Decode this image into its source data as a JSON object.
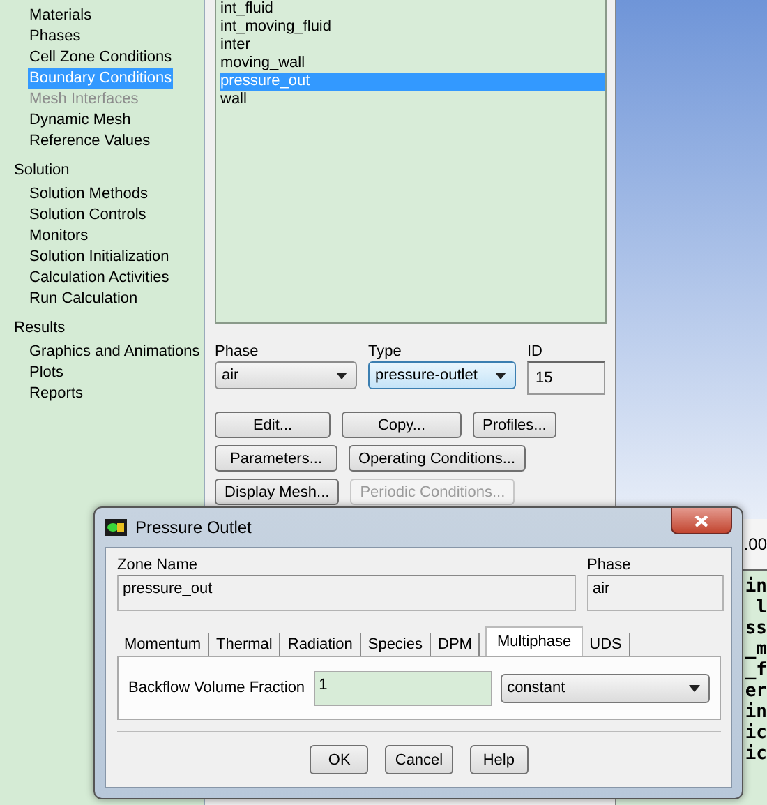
{
  "sidebar": {
    "groups": [
      {
        "items": [
          {
            "label": "Materials",
            "selected": false,
            "disabled": false
          },
          {
            "label": "Phases",
            "selected": false,
            "disabled": false
          },
          {
            "label": "Cell Zone Conditions",
            "selected": false,
            "disabled": false
          },
          {
            "label": "Boundary Conditions",
            "selected": true,
            "disabled": false
          },
          {
            "label": "Mesh Interfaces",
            "selected": false,
            "disabled": true
          },
          {
            "label": "Dynamic Mesh",
            "selected": false,
            "disabled": false
          },
          {
            "label": "Reference Values",
            "selected": false,
            "disabled": false
          }
        ]
      },
      {
        "title": "Solution",
        "items": [
          {
            "label": "Solution Methods",
            "selected": false,
            "disabled": false
          },
          {
            "label": "Solution Controls",
            "selected": false,
            "disabled": false
          },
          {
            "label": "Monitors",
            "selected": false,
            "disabled": false
          },
          {
            "label": "Solution Initialization",
            "selected": false,
            "disabled": false
          },
          {
            "label": "Calculation Activities",
            "selected": false,
            "disabled": false
          },
          {
            "label": "Run Calculation",
            "selected": false,
            "disabled": false
          }
        ]
      },
      {
        "title": "Results",
        "items": [
          {
            "label": "Graphics and Animations",
            "selected": false,
            "disabled": false
          },
          {
            "label": "Plots",
            "selected": false,
            "disabled": false
          },
          {
            "label": "Reports",
            "selected": false,
            "disabled": false
          }
        ]
      }
    ]
  },
  "zones": {
    "items": [
      {
        "label": "int_fluid",
        "selected": false
      },
      {
        "label": "int_moving_fluid",
        "selected": false
      },
      {
        "label": "inter",
        "selected": false
      },
      {
        "label": "moving_wall",
        "selected": false
      },
      {
        "label": "pressure_out",
        "selected": true
      },
      {
        "label": "wall",
        "selected": false
      }
    ],
    "phase": {
      "label": "Phase",
      "value": "air"
    },
    "type": {
      "label": "Type",
      "value": "pressure-outlet"
    },
    "id": {
      "label": "ID",
      "value": "15"
    },
    "buttons": [
      [
        {
          "label": "Edit...",
          "disabled": false
        },
        {
          "label": "Copy...",
          "disabled": false
        },
        {
          "label": "Profiles...",
          "disabled": false
        }
      ],
      [
        {
          "label": "Parameters...",
          "disabled": false
        },
        {
          "label": "Operating Conditions...",
          "disabled": false
        }
      ],
      [
        {
          "label": "Display Mesh...",
          "disabled": false
        },
        {
          "label": "Periodic Conditions...",
          "disabled": true
        }
      ]
    ]
  },
  "console": {
    "reading": ".00",
    "lines": [
      "in",
      "l",
      "ss",
      "_m",
      "_f",
      "er",
      "in",
      "ic",
      "ic"
    ]
  },
  "dialog": {
    "title": "Pressure Outlet",
    "zone_name": {
      "label": "Zone Name",
      "value": "pressure_out"
    },
    "phase": {
      "label": "Phase",
      "value": "air"
    },
    "tabs": [
      {
        "label": "Momentum",
        "selected": false
      },
      {
        "label": "Thermal",
        "selected": false
      },
      {
        "label": "Radiation",
        "selected": false
      },
      {
        "label": "Species",
        "selected": false
      },
      {
        "label": "DPM",
        "selected": false
      },
      {
        "label": "Multiphase",
        "selected": true
      },
      {
        "label": "UDS",
        "selected": false
      }
    ],
    "backflow": {
      "label": "Backflow Volume Fraction",
      "value": "1",
      "method": "constant"
    },
    "buttons": [
      "OK",
      "Cancel",
      "Help"
    ]
  }
}
